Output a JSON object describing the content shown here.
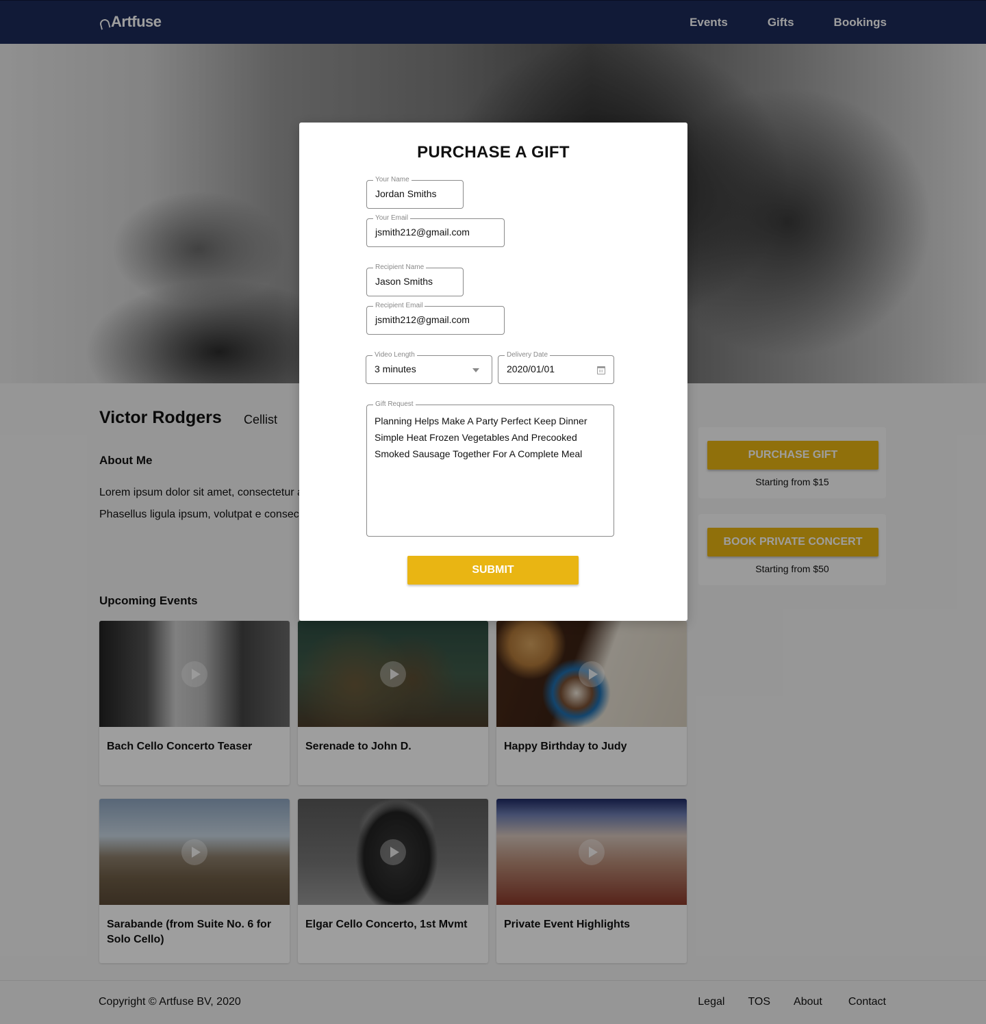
{
  "header": {
    "logo": "Artfuse",
    "nav": [
      "Events",
      "Gifts",
      "Bookings"
    ]
  },
  "profile": {
    "name": "Victor Rodgers",
    "role": "Cellist",
    "about_title": "About Me",
    "about_text": "Lorem ipsum dolor sit amet, consectetur adipiscing elit. Maecenas volutpat ante semper diam molestie, et efficitur nunc. Phasellus ligula ipsum, volutpat e consectetur ante at nisl hendrerit gravid"
  },
  "events": {
    "title": "Upcoming Events",
    "items": [
      {
        "title": "Bach Cello Concerto Teaser"
      },
      {
        "title": "Serenade to John D."
      },
      {
        "title": "Happy Birthday to Judy"
      },
      {
        "title": "Sarabande (from Suite No. 6 for Solo Cello)"
      },
      {
        "title": "Elgar Cello Concerto, 1st Mvmt"
      },
      {
        "title": "Private Event Highlights"
      }
    ]
  },
  "sidebar": {
    "gift": {
      "button": "PURCHASE GIFT",
      "subtitle": "Starting from $15"
    },
    "concert": {
      "button": "BOOK PRIVATE CONCERT",
      "subtitle": "Starting from $50"
    }
  },
  "modal": {
    "title": "PURCHASE A GIFT",
    "your_name": {
      "label": "Your Name",
      "value": "Jordan Smiths"
    },
    "your_email": {
      "label": "Your Email",
      "value": "jsmith212@gmail.com"
    },
    "recipient_name": {
      "label": "Recipient Name",
      "value": "Jason Smiths"
    },
    "recipient_email": {
      "label": "Recipient Email",
      "value": "jsmith212@gmail.com"
    },
    "video_length": {
      "label": "Video Length",
      "value": "3 minutes"
    },
    "delivery_date": {
      "label": "Delivery Date",
      "value": "2020/01/01"
    },
    "gift_request": {
      "label": "Gift Request",
      "value": "Planning Helps Make A Party Perfect Keep Dinner Simple Heat Frozen Vegetables And Precooked Smoked Sausage Together For A Complete Meal"
    },
    "submit": "SUBMIT"
  },
  "footer": {
    "copyright": "Copyright © Artfuse BV, 2020",
    "links": [
      "Legal",
      "TOS",
      "About",
      "Contact"
    ]
  },
  "colors": {
    "header_bg": "#1c2a5a",
    "accent": "#e9b513",
    "overlay": "rgba(0,0,0,0.38)"
  }
}
